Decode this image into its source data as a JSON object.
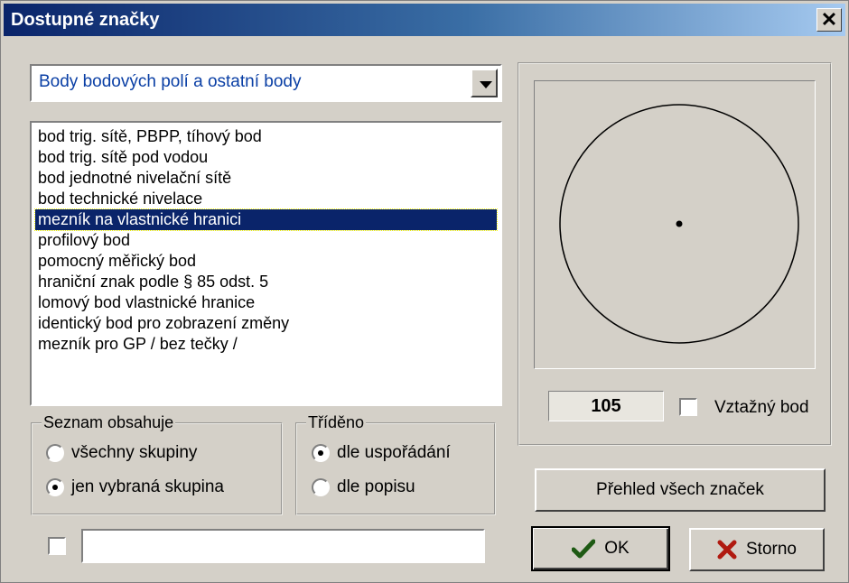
{
  "window": {
    "title": "Dostupné značky",
    "close_glyph": "✕"
  },
  "category": {
    "selected": "Body bodových polí a ostatní body"
  },
  "marks_list": {
    "items": [
      "bod trig. sítě, PBPP, tíhový bod",
      "bod trig. sítě pod vodou",
      "bod jednotné nivelační sítě",
      "bod technické nivelace",
      "mezník na vlastnické hranici",
      "profilový bod",
      "pomocný měřický bod",
      "hraniční znak podle § 85 odst. 5",
      "lomový bod vlastnické hranice",
      "identický bod pro zobrazení změny",
      "mezník pro GP / bez tečky /"
    ],
    "selected_index": 4
  },
  "list_contains": {
    "label": "Seznam obsahuje",
    "options": [
      "všechny skupiny",
      "jen vybraná skupina"
    ],
    "selected_index": 1
  },
  "sorted": {
    "label": "Tříděno",
    "options": [
      "dle uspořádání",
      "dle popisu"
    ],
    "selected_index": 0
  },
  "filter": {
    "checked": false,
    "value": ""
  },
  "preview": {
    "code": "105",
    "reference_point_label": "Vztažný bod",
    "reference_point_checked": false
  },
  "buttons": {
    "overview": "Přehled všech značek",
    "ok": "OK",
    "cancel": "Storno"
  },
  "icons": {
    "ok": "check-icon",
    "cancel": "x-icon"
  },
  "colors": {
    "ok_check": "#1e5a14",
    "cancel_x": "#b01a10",
    "selection": "#0a246a",
    "title_start": "#0a246a"
  }
}
